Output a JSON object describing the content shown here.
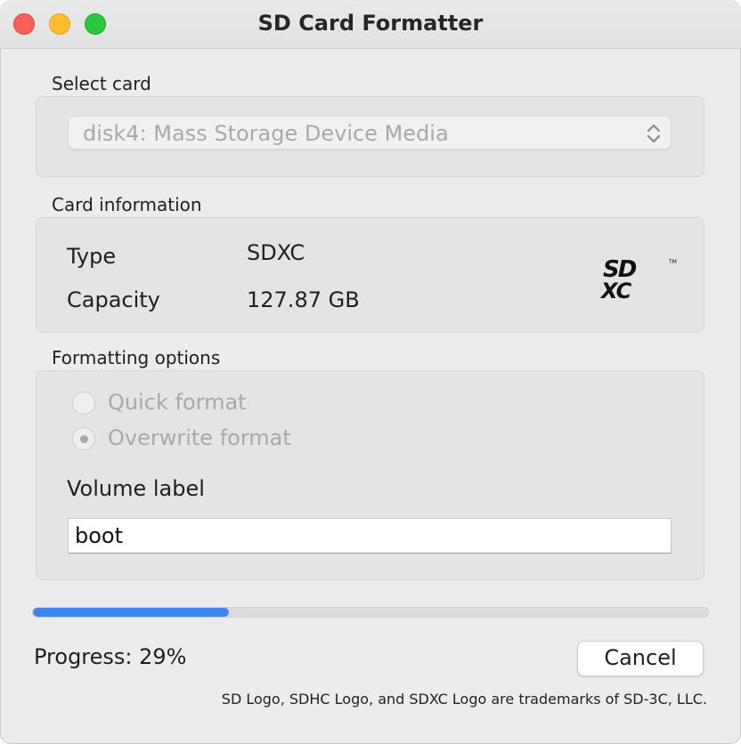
{
  "window": {
    "title": "SD Card Formatter"
  },
  "select_card": {
    "label": "Select card",
    "selected": "disk4: Mass Storage Device Media"
  },
  "card_info": {
    "label": "Card information",
    "type_label": "Type",
    "type_value": "SDXC",
    "capacity_label": "Capacity",
    "capacity_value": "127.87 GB",
    "logo": "sdxc-logo"
  },
  "formatting": {
    "label": "Formatting options",
    "quick_format": "Quick format",
    "overwrite_format": "Overwrite format",
    "selected_option": "Overwrite format",
    "volume_label": "Volume label",
    "volume_value": "boot"
  },
  "progress": {
    "text": "Progress: 29%",
    "value": 0.29
  },
  "buttons": {
    "cancel": "Cancel"
  },
  "footer": {
    "trademark": "SD Logo, SDHC Logo, and SDXC Logo are trademarks of SD-3C, LLC."
  },
  "colors": {
    "accent": "#3e84f1",
    "close": "#fe5f57",
    "minimize": "#febc2e",
    "maximize": "#28c840"
  }
}
